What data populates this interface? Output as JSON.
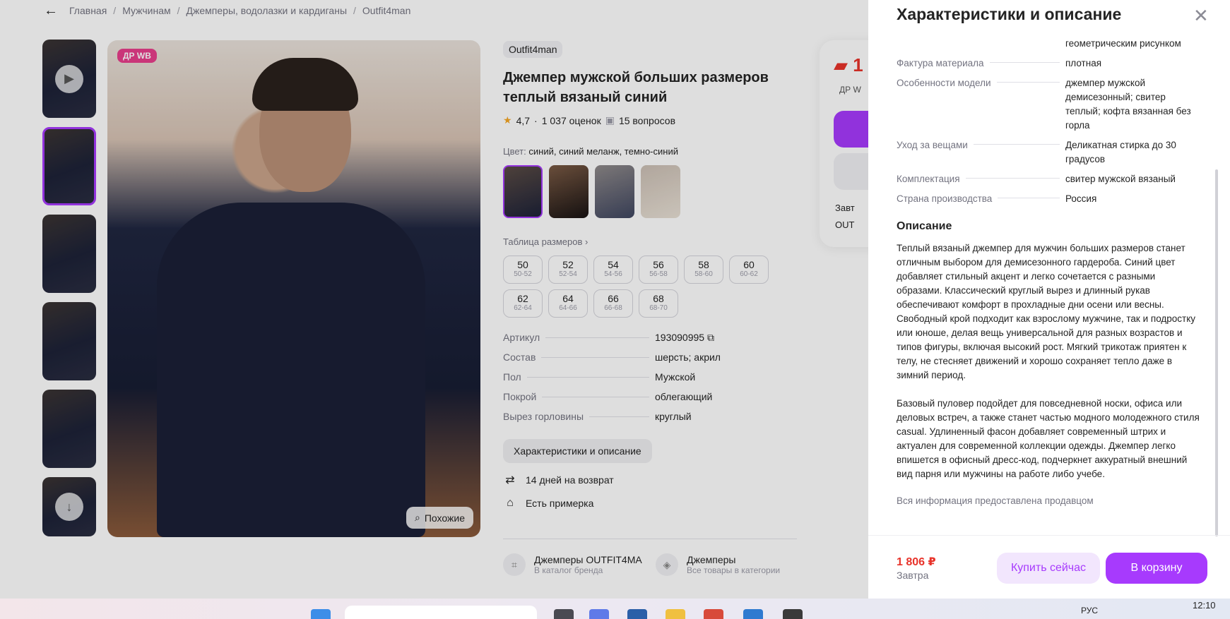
{
  "breadcrumbs": [
    "Главная",
    "Мужчинам",
    "Джемперы, водолазки и кардиганы",
    "Outfit4man"
  ],
  "product": {
    "badge": "ДР WB",
    "similar_label": "Похожие",
    "brand": "Outfit4man",
    "title": "Джемпер мужской больших размеров теплый вязаный синий",
    "rating": "4,7",
    "reviews": "1 037 оценок",
    "questions": "15 вопросов",
    "color_label": "Цвет:",
    "color_value": "синий, синий меланж, темно-синий",
    "size_table_label": "Таблица размеров",
    "sizes": [
      {
        "n": "50",
        "r": "50-52"
      },
      {
        "n": "52",
        "r": "52-54"
      },
      {
        "n": "54",
        "r": "54-56"
      },
      {
        "n": "56",
        "r": "56-58"
      },
      {
        "n": "58",
        "r": "58-60"
      },
      {
        "n": "60",
        "r": "60-62"
      },
      {
        "n": "62",
        "r": "62-64"
      },
      {
        "n": "64",
        "r": "64-66"
      },
      {
        "n": "66",
        "r": "66-68"
      },
      {
        "n": "68",
        "r": "68-70"
      }
    ],
    "specs": [
      {
        "k": "Артикул",
        "v": "193090995"
      },
      {
        "k": "Состав",
        "v": "шерсть; акрил"
      },
      {
        "k": "Пол",
        "v": "Мужской"
      },
      {
        "k": "Покрой",
        "v": "облегающий"
      },
      {
        "k": "Вырез горловины",
        "v": "круглый"
      }
    ],
    "characteristics_button": "Характеристики и описание",
    "perks": [
      "14 дней на возврат",
      "Есть примерка"
    ],
    "links": [
      {
        "t1": "Джемперы OUTFIT4MA",
        "t2": "В каталог бренда"
      },
      {
        "t1": "Джемперы",
        "t2": "Все товары в категории"
      }
    ]
  },
  "buybox": {
    "price": "1",
    "dr": "ДР W",
    "line1": "Завт",
    "line2": "OUT"
  },
  "drawer": {
    "title": "Характеристики и описание",
    "specs": [
      {
        "k": "",
        "v": "геометрическим рисунком"
      },
      {
        "k": "Фактура материала",
        "v": "плотная"
      },
      {
        "k": "Особенности модели",
        "v": "джемпер мужской демисезонный; свитер теплый; кофта вязанная без горла"
      },
      {
        "k": "Уход за вещами",
        "v": "Деликатная стирка до 30 градусов"
      },
      {
        "k": "Комплектация",
        "v": "свитер мужской вязаный"
      },
      {
        "k": "Страна производства",
        "v": "Россия"
      }
    ],
    "description_heading": "Описание",
    "paragraph1": "Теплый вязаный джемпер для мужчин больших размеров станет отличным выбором для демисезонного гардероба. Синий цвет добавляет стильный акцент и легко сочетается с разными образами. Классический круглый вырез и длинный рукав обеспечивают комфорт в прохладные дни осени или весны. Свободный крой подходит как взрослому мужчине, так и подростку или юноше, делая вещь универсальной для разных возрастов и типов фигуры, включая высокий рост. Мягкий трикотаж приятен к телу, не стесняет движений и хорошо сохраняет тепло даже в зимний период.",
    "paragraph2": "Базовый пуловер подойдет для повседневной носки, офиса или деловых встреч, а также станет частью модного молодежного стиля casual. Удлиненный фасон добавляет современный штрих и актуален для современной коллекции одежды. Джемпер легко впишется в офисный дресс-код, подчеркнет аккуратный внешний вид парня или мужчины на работе либо учебе.",
    "note": "Вся информация предоставлена продавцом",
    "price": "1 806 ₽",
    "delivery": "Завтра",
    "buy_now": "Купить сейчас",
    "to_cart": "В корзину"
  },
  "taskbar": {
    "lang": "РУС",
    "time": "12:10"
  },
  "colors": {
    "accent": "#a73afd",
    "price": "#e8332a",
    "badge": "#e83e8c"
  }
}
